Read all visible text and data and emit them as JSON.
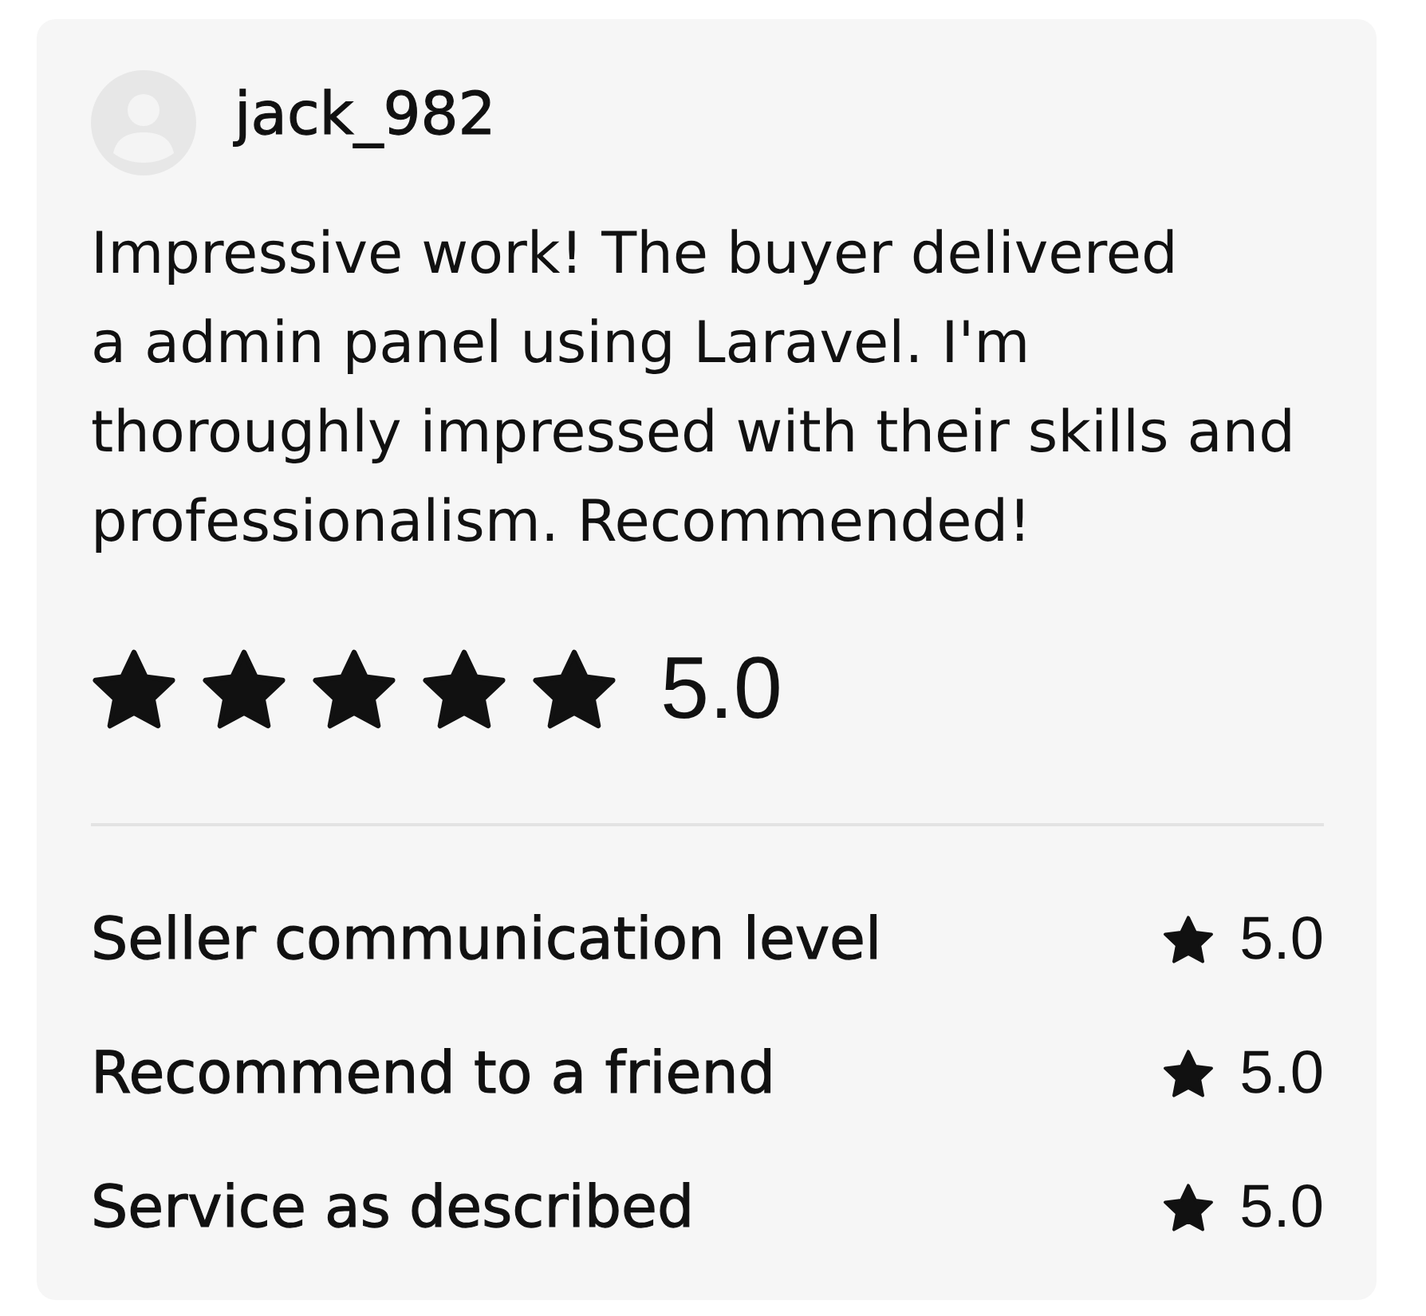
{
  "review": {
    "username": "jack_982",
    "text": "Impressive work! The buyer delivered\na admin panel using Laravel. I'm thoroughly impressed with their skills and professionalism. Recommended!",
    "stars": 5,
    "rating": "5.0"
  },
  "criteria": [
    {
      "label": "Seller communication level",
      "rating": "5.0"
    },
    {
      "label": "Recommend to a friend",
      "rating": "5.0"
    },
    {
      "label": "Service as described",
      "rating": "5.0"
    }
  ]
}
